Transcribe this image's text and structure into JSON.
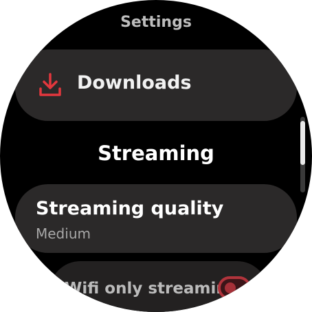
{
  "screen": {
    "title": "Settings",
    "section_header": "Streaming"
  },
  "downloads": {
    "label": "Downloads",
    "icon": "download-icon",
    "icon_color": "#e3373d"
  },
  "streaming_quality": {
    "label": "Streaming quality",
    "value": "Medium"
  },
  "wifi_only": {
    "label": "Wifi only streaming",
    "toggle_on": true,
    "accent": "#b1343c"
  }
}
